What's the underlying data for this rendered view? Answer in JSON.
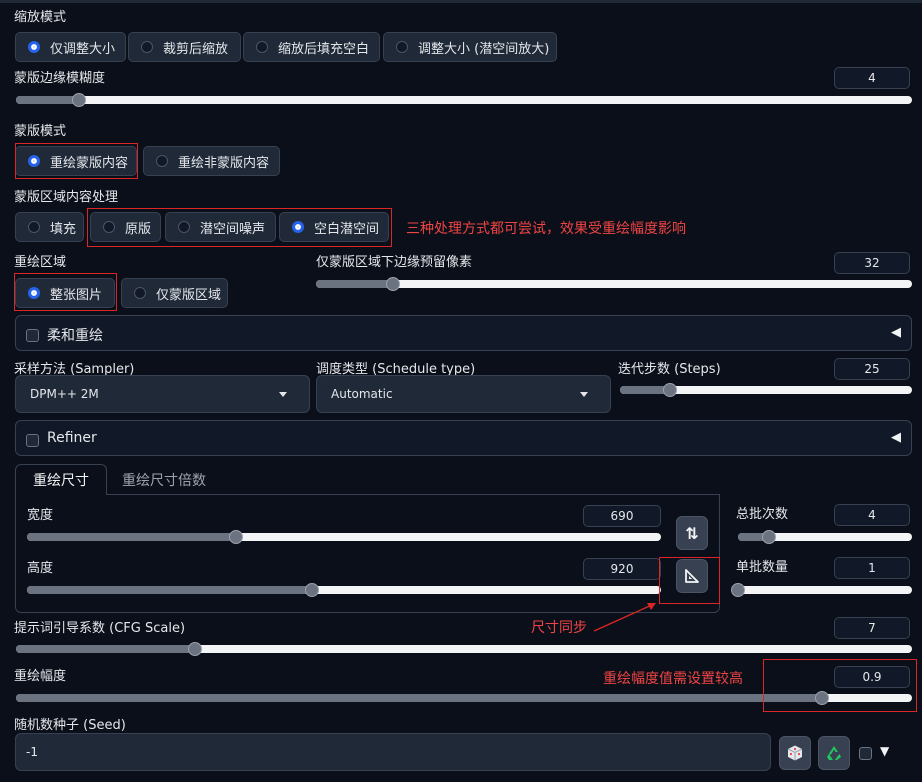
{
  "resize_mode": {
    "label": "缩放模式",
    "options": [
      "仅调整大小",
      "裁剪后缩放",
      "缩放后填充空白",
      "调整大小 (潜空间放大)"
    ],
    "selected": "仅调整大小"
  },
  "mask_blur": {
    "label": "蒙版边缘模糊度",
    "value": "4",
    "fraction": 0.07
  },
  "mask_mode": {
    "label": "蒙版模式",
    "options": [
      "重绘蒙版内容",
      "重绘非蒙版内容"
    ],
    "selected": "重绘蒙版内容"
  },
  "masked_content": {
    "label": "蒙版区域内容处理",
    "options": [
      "填充",
      "原版",
      "潜空间噪声",
      "空白潜空间"
    ],
    "selected": "空白潜空间"
  },
  "inpaint_area": {
    "label": "重绘区域",
    "options": [
      "整张图片",
      "仅蒙版区域"
    ],
    "selected": "整张图片"
  },
  "only_masked_padding": {
    "label": "仅蒙版区域下边缘预留像素",
    "value": "32",
    "fraction": 0.13
  },
  "soft_inpainting": {
    "label": "柔和重绘",
    "toggle_glyph": "◀"
  },
  "sampler": {
    "label": "采样方法 (Sampler)",
    "value": "DPM++ 2M"
  },
  "schedule_type": {
    "label": "调度类型 (Schedule type)",
    "value": "Automatic"
  },
  "steps": {
    "label": "迭代步数 (Steps)",
    "value": "25",
    "fraction": 0.17
  },
  "refiner": {
    "label": "Refiner",
    "toggle_glyph": "◀"
  },
  "size_tabs": {
    "active": "重绘尺寸",
    "inactive": "重绘尺寸倍数"
  },
  "width": {
    "label": "宽度",
    "value": "690",
    "fraction": 0.33
  },
  "height": {
    "label": "高度",
    "value": "920",
    "fraction": 0.45
  },
  "swap_icon_glyph": "⇅",
  "batch_count": {
    "label": "总批次数",
    "value": "4",
    "fraction": 0.18
  },
  "batch_size": {
    "label": "单批数量",
    "value": "1",
    "fraction": 0.0
  },
  "cfg_scale": {
    "label": "提示词引导系数 (CFG Scale)",
    "value": "7",
    "fraction": 0.2
  },
  "denoising": {
    "label": "重绘幅度",
    "value": "0.9",
    "fraction": 0.9
  },
  "seed": {
    "label": "随机数种子 (Seed)",
    "value": "-1",
    "extra_glyph": "▼"
  },
  "annotations": {
    "processing_note": "三种处理方式都可尝试，效果受重绘幅度影响",
    "size_sync_note": "尺寸同步",
    "denoise_note": "重绘幅度值需设置较高"
  },
  "colors": {
    "accent": "#2563eb",
    "annotation": "#dc2626",
    "background": "#0b0f19",
    "recycle": "#22c55e"
  }
}
